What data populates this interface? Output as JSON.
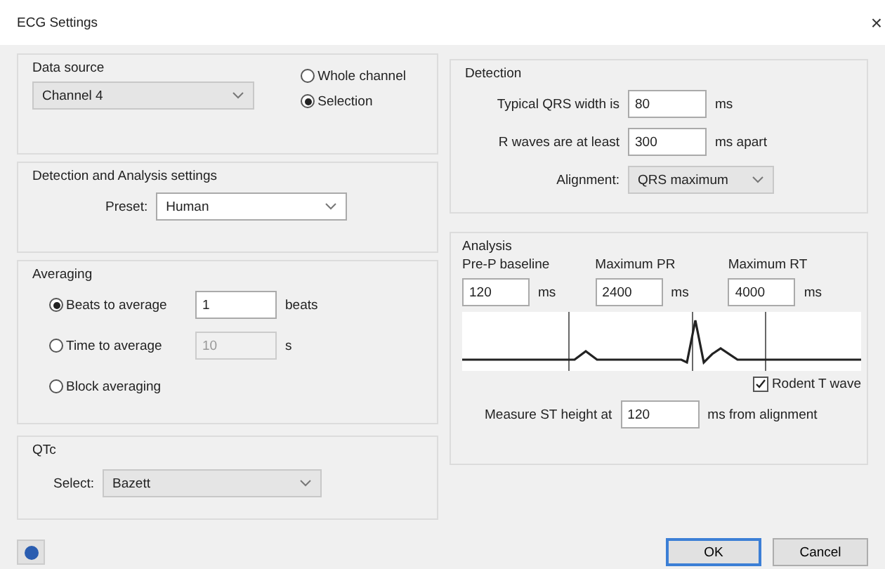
{
  "window": {
    "title": "ECG Settings",
    "close": "×"
  },
  "data_source": {
    "title": "Data source",
    "channel": "Channel 4",
    "options": [
      {
        "label": "Whole channel",
        "selected": false
      },
      {
        "label": "Selection",
        "selected": true
      }
    ]
  },
  "detection_analysis": {
    "title": "Detection and Analysis settings",
    "preset_label": "Preset:",
    "preset": "Human"
  },
  "averaging": {
    "title": "Averaging",
    "options": [
      {
        "label": "Beats to average",
        "selected": true,
        "value": "1",
        "unit": "beats"
      },
      {
        "label": "Time to average",
        "selected": false,
        "value": "10",
        "unit": "s"
      },
      {
        "label": "Block averaging",
        "selected": false
      }
    ]
  },
  "qtc": {
    "title": "QTc",
    "select_label": "Select:",
    "value": "Bazett"
  },
  "detection": {
    "title": "Detection",
    "fields": [
      {
        "label": "Typical QRS width is",
        "value": "80",
        "unit": "ms"
      },
      {
        "label": "R waves are at least",
        "value": "300",
        "unit": "ms apart"
      }
    ],
    "alignment_label": "Alignment:",
    "alignment": "QRS maximum"
  },
  "analysis": {
    "title": "Analysis",
    "fields": [
      {
        "label": "Pre-P baseline",
        "value": "120",
        "unit": "ms"
      },
      {
        "label": "Maximum PR",
        "value": "2400",
        "unit": "ms"
      },
      {
        "label": "Maximum RT",
        "value": "4000",
        "unit": "ms"
      }
    ],
    "rodent_t_wave": {
      "label": "Rodent T wave",
      "checked": true
    },
    "st_label": "Measure ST height at",
    "st_value": "120",
    "st_unit": "ms from alignment"
  },
  "buttons": [
    {
      "label": "OK",
      "default": true
    },
    {
      "label": "Cancel",
      "default": false
    }
  ]
}
